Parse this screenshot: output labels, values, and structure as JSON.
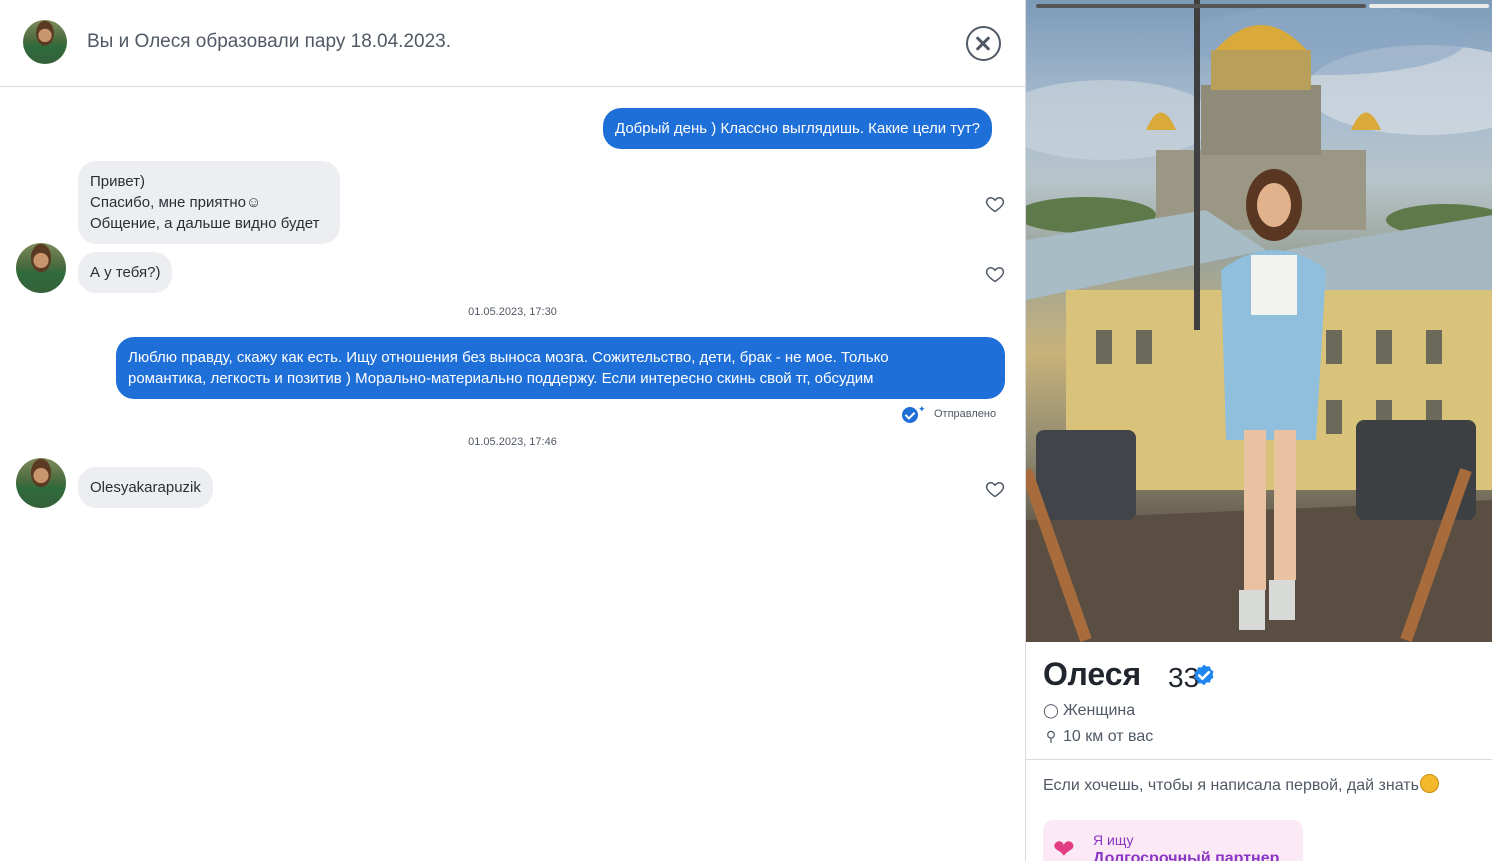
{
  "header": {
    "title": "Вы и Олеся образовали пару 18.04.2023."
  },
  "messages": {
    "m1": {
      "text": "Добрый день ) Классно выглядишь. Какие цели тут?"
    },
    "m2": {
      "lines": [
        "Привет)",
        "Спасибо, мне приятно☺",
        "Общение, а дальше видно будет"
      ]
    },
    "m3": {
      "text": "А у тебя?)"
    },
    "ts1": "01.05.2023, 17:30",
    "m4": {
      "lines": [
        "Люблю правду, скажу как есть. Ищу отношения без выноса мозга. Сожительство, дети, брак - не мое. Только",
        "романтика, легкость и позитив ) Морально-материально поддержу. Если интересно скинь свой тг, обсудим"
      ]
    },
    "status": "Отправлено",
    "ts2": "01.05.2023, 17:46",
    "m5": {
      "text": "Olesyakarapuzik"
    }
  },
  "profile": {
    "name": "Олеся",
    "age": "33",
    "gender": "Женщина",
    "distance": "10 км от вас",
    "bio": "Если хочешь, чтобы я написала первой, дай знать",
    "looking_label": "Я ищу",
    "looking_value": "Долгосрочный партнер"
  },
  "colors": {
    "outgoing_bubble": "#1f6fd9",
    "incoming_bubble": "#edeef1",
    "verified": "#1f86ef"
  },
  "icons": {
    "close": "close-icon",
    "heart": "heart-outline-icon",
    "verified": "verified-check-icon",
    "gender": "person-icon",
    "location": "location-pin-icon",
    "looking": "hearts-arrow-icon"
  }
}
